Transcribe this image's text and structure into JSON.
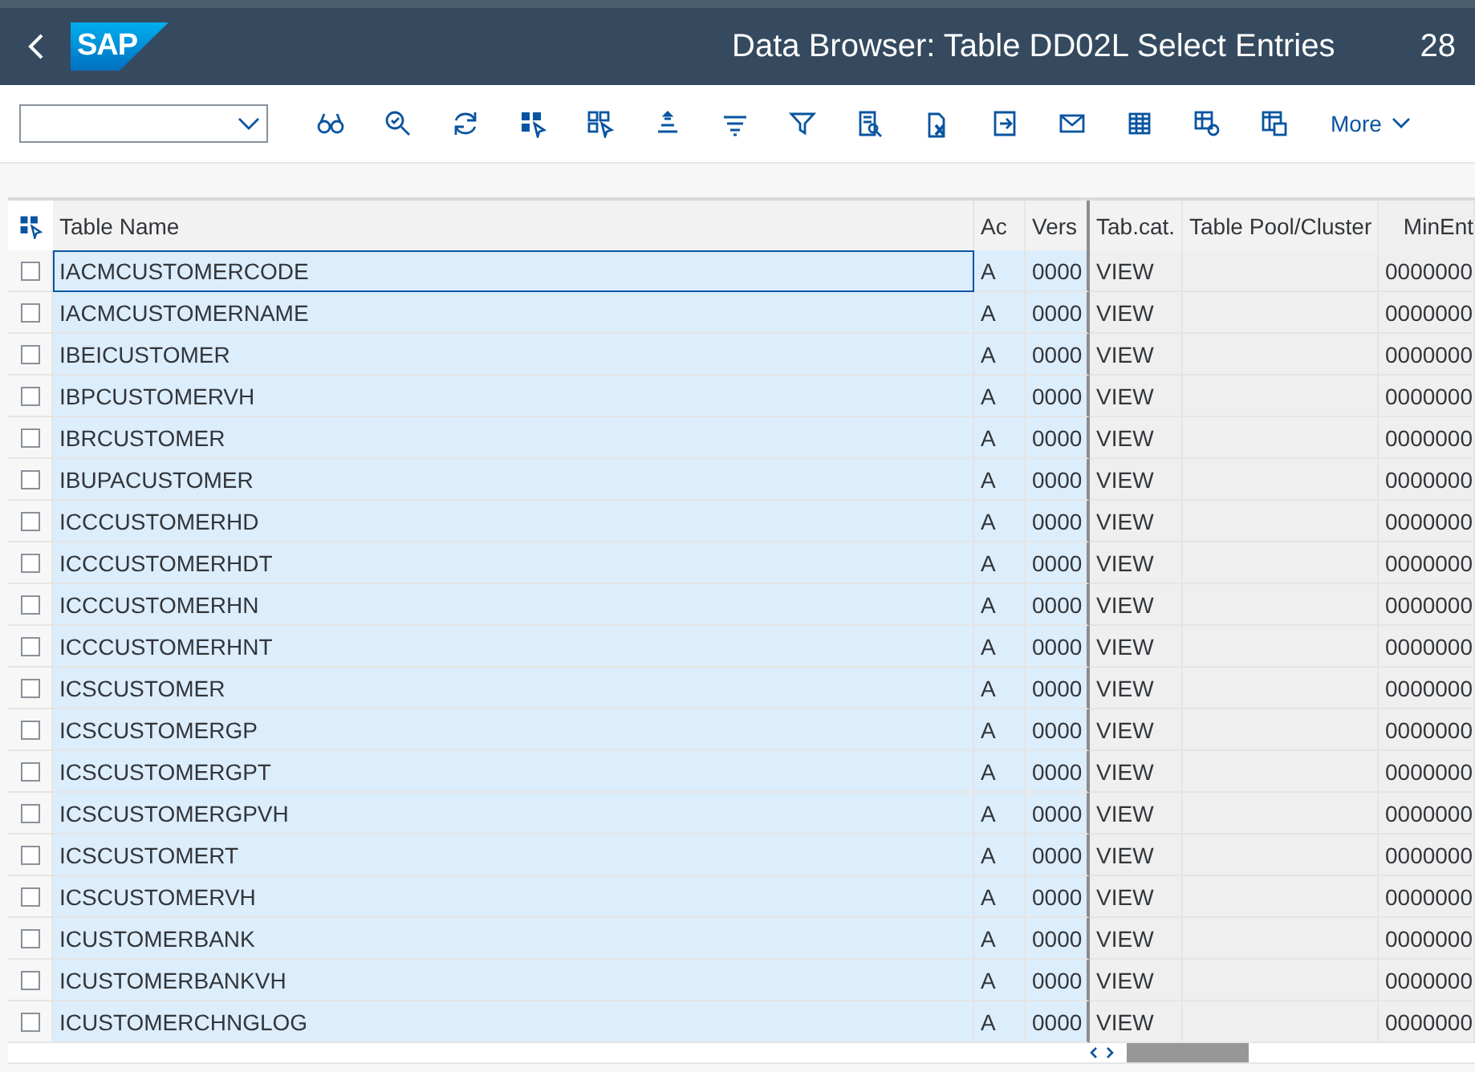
{
  "shell": {
    "logo": "SAP",
    "title": "Data Browser: Table DD02L Select Entries",
    "client": "28"
  },
  "toolbar": {
    "more": "More"
  },
  "table": {
    "columns": [
      {
        "label": "Table Name",
        "kind": "key"
      },
      {
        "label": "Ac",
        "kind": "key"
      },
      {
        "label": "Vers",
        "kind": "key"
      },
      {
        "label": "Tab.cat.",
        "kind": "plain"
      },
      {
        "label": "Table Pool/Cluster",
        "kind": "plain"
      },
      {
        "label": "MinEnt",
        "kind": "num"
      }
    ],
    "rows": [
      {
        "selected": false,
        "focused": true,
        "cells": [
          "IACMCUSTOMERCODE",
          "A",
          "0000",
          "VIEW",
          null,
          "0000000"
        ]
      },
      {
        "selected": false,
        "focused": false,
        "cells": [
          "IACMCUSTOMERNAME",
          "A",
          "0000",
          "VIEW",
          null,
          "0000000"
        ]
      },
      {
        "selected": false,
        "focused": false,
        "cells": [
          "IBEICUSTOMER",
          "A",
          "0000",
          "VIEW",
          null,
          "0000000"
        ]
      },
      {
        "selected": false,
        "focused": false,
        "cells": [
          "IBPCUSTOMERVH",
          "A",
          "0000",
          "VIEW",
          null,
          "0000000"
        ]
      },
      {
        "selected": false,
        "focused": false,
        "cells": [
          "IBRCUSTOMER",
          "A",
          "0000",
          "VIEW",
          null,
          "0000000"
        ]
      },
      {
        "selected": false,
        "focused": false,
        "cells": [
          "IBUPACUSTOMER",
          "A",
          "0000",
          "VIEW",
          null,
          "0000000"
        ]
      },
      {
        "selected": false,
        "focused": false,
        "cells": [
          "ICCCUSTOMERHD",
          "A",
          "0000",
          "VIEW",
          null,
          "0000000"
        ]
      },
      {
        "selected": false,
        "focused": false,
        "cells": [
          "ICCCUSTOMERHDT",
          "A",
          "0000",
          "VIEW",
          null,
          "0000000"
        ]
      },
      {
        "selected": false,
        "focused": false,
        "cells": [
          "ICCCUSTOMERHN",
          "A",
          "0000",
          "VIEW",
          null,
          "0000000"
        ]
      },
      {
        "selected": false,
        "focused": false,
        "cells": [
          "ICCCUSTOMERHNT",
          "A",
          "0000",
          "VIEW",
          null,
          "0000000"
        ]
      },
      {
        "selected": false,
        "focused": false,
        "cells": [
          "ICSCUSTOMER",
          "A",
          "0000",
          "VIEW",
          null,
          "0000000"
        ]
      },
      {
        "selected": false,
        "focused": false,
        "cells": [
          "ICSCUSTOMERGP",
          "A",
          "0000",
          "VIEW",
          null,
          "0000000"
        ]
      },
      {
        "selected": false,
        "focused": false,
        "cells": [
          "ICSCUSTOMERGPT",
          "A",
          "0000",
          "VIEW",
          null,
          "0000000"
        ]
      },
      {
        "selected": false,
        "focused": false,
        "cells": [
          "ICSCUSTOMERGPVH",
          "A",
          "0000",
          "VIEW",
          null,
          "0000000"
        ]
      },
      {
        "selected": false,
        "focused": false,
        "cells": [
          "ICSCUSTOMERT",
          "A",
          "0000",
          "VIEW",
          null,
          "0000000"
        ]
      },
      {
        "selected": false,
        "focused": false,
        "cells": [
          "ICSCUSTOMERVH",
          "A",
          "0000",
          "VIEW",
          null,
          "0000000"
        ]
      },
      {
        "selected": false,
        "focused": false,
        "cells": [
          "ICUSTOMERBANK",
          "A",
          "0000",
          "VIEW",
          null,
          "0000000"
        ]
      },
      {
        "selected": false,
        "focused": false,
        "cells": [
          "ICUSTOMERBANKVH",
          "A",
          "0000",
          "VIEW",
          null,
          "0000000"
        ]
      },
      {
        "selected": false,
        "focused": false,
        "cells": [
          "ICUSTOMERCHNGLOG",
          "A",
          "0000",
          "VIEW",
          null,
          "0000000"
        ]
      }
    ]
  }
}
